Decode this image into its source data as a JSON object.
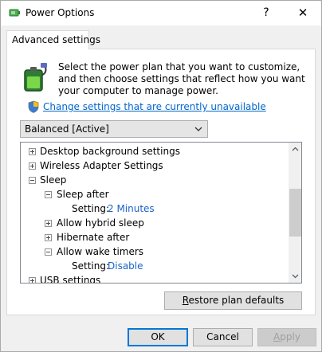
{
  "window": {
    "title": "Power Options",
    "help_label": "?",
    "close_label": "✕"
  },
  "tab": {
    "label": "Advanced settings"
  },
  "intro_text": "Select the power plan that you want to customize, and then choose settings that reflect how you want your computer to manage power.",
  "change_settings_link": "Change settings that are currently unavailable",
  "plan_select": {
    "value": "Balanced [Active]"
  },
  "tree": [
    {
      "label": "Desktop background settings",
      "expanded": false
    },
    {
      "label": "Wireless Adapter Settings",
      "expanded": false
    },
    {
      "label": "Sleep",
      "expanded": true
    },
    {
      "label": "Sleep after",
      "expanded": true
    },
    {
      "label": "Setting:",
      "value": "2 Minutes"
    },
    {
      "label": "Allow hybrid sleep",
      "expanded": false
    },
    {
      "label": "Hibernate after",
      "expanded": false
    },
    {
      "label": "Allow wake timers",
      "expanded": true
    },
    {
      "label": "Setting:",
      "value": "Disable"
    },
    {
      "label": "USB settings",
      "expanded": false
    }
  ],
  "buttons": {
    "restore_pre": "R",
    "restore_rest": "estore plan defaults",
    "ok": "OK",
    "cancel": "Cancel",
    "apply_pre": "A",
    "apply_rest": "pply"
  },
  "icons": {
    "app": "power-options-icon",
    "battery": "battery-plug-icon",
    "shield": "uac-shield-icon",
    "dropdown": "chevron-down-icon",
    "scroll_up": "scroll-up-icon",
    "scroll_down": "scroll-down-icon"
  },
  "colors": {
    "link": "#0066cc",
    "setting_value": "#1a63c7",
    "ok_border": "#0078d7"
  }
}
